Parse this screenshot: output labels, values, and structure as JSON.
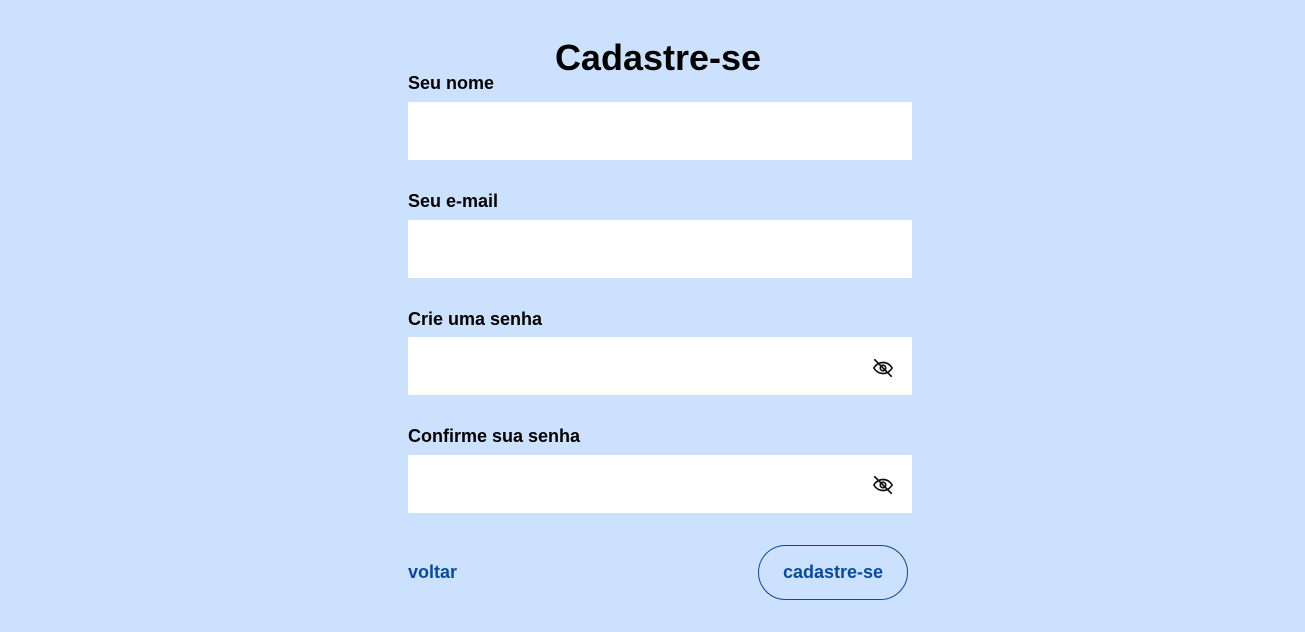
{
  "page": {
    "title": "Cadastre-se"
  },
  "form": {
    "name": {
      "label": "Seu nome",
      "value": "",
      "placeholder": ""
    },
    "email": {
      "label": "Seu e-mail",
      "value": "",
      "placeholder": ""
    },
    "password": {
      "label": "Crie uma senha",
      "value": "",
      "placeholder": "",
      "toggle_icon": "eye-off-icon"
    },
    "confirm_password": {
      "label": "Confirme sua senha",
      "value": "",
      "placeholder": "",
      "toggle_icon": "eye-off-icon"
    }
  },
  "actions": {
    "back_label": "voltar",
    "submit_label": "cadastre-se"
  },
  "colors": {
    "background": "#cbe1fd",
    "accent": "#0a4a9e",
    "input_background": "#ffffff"
  }
}
